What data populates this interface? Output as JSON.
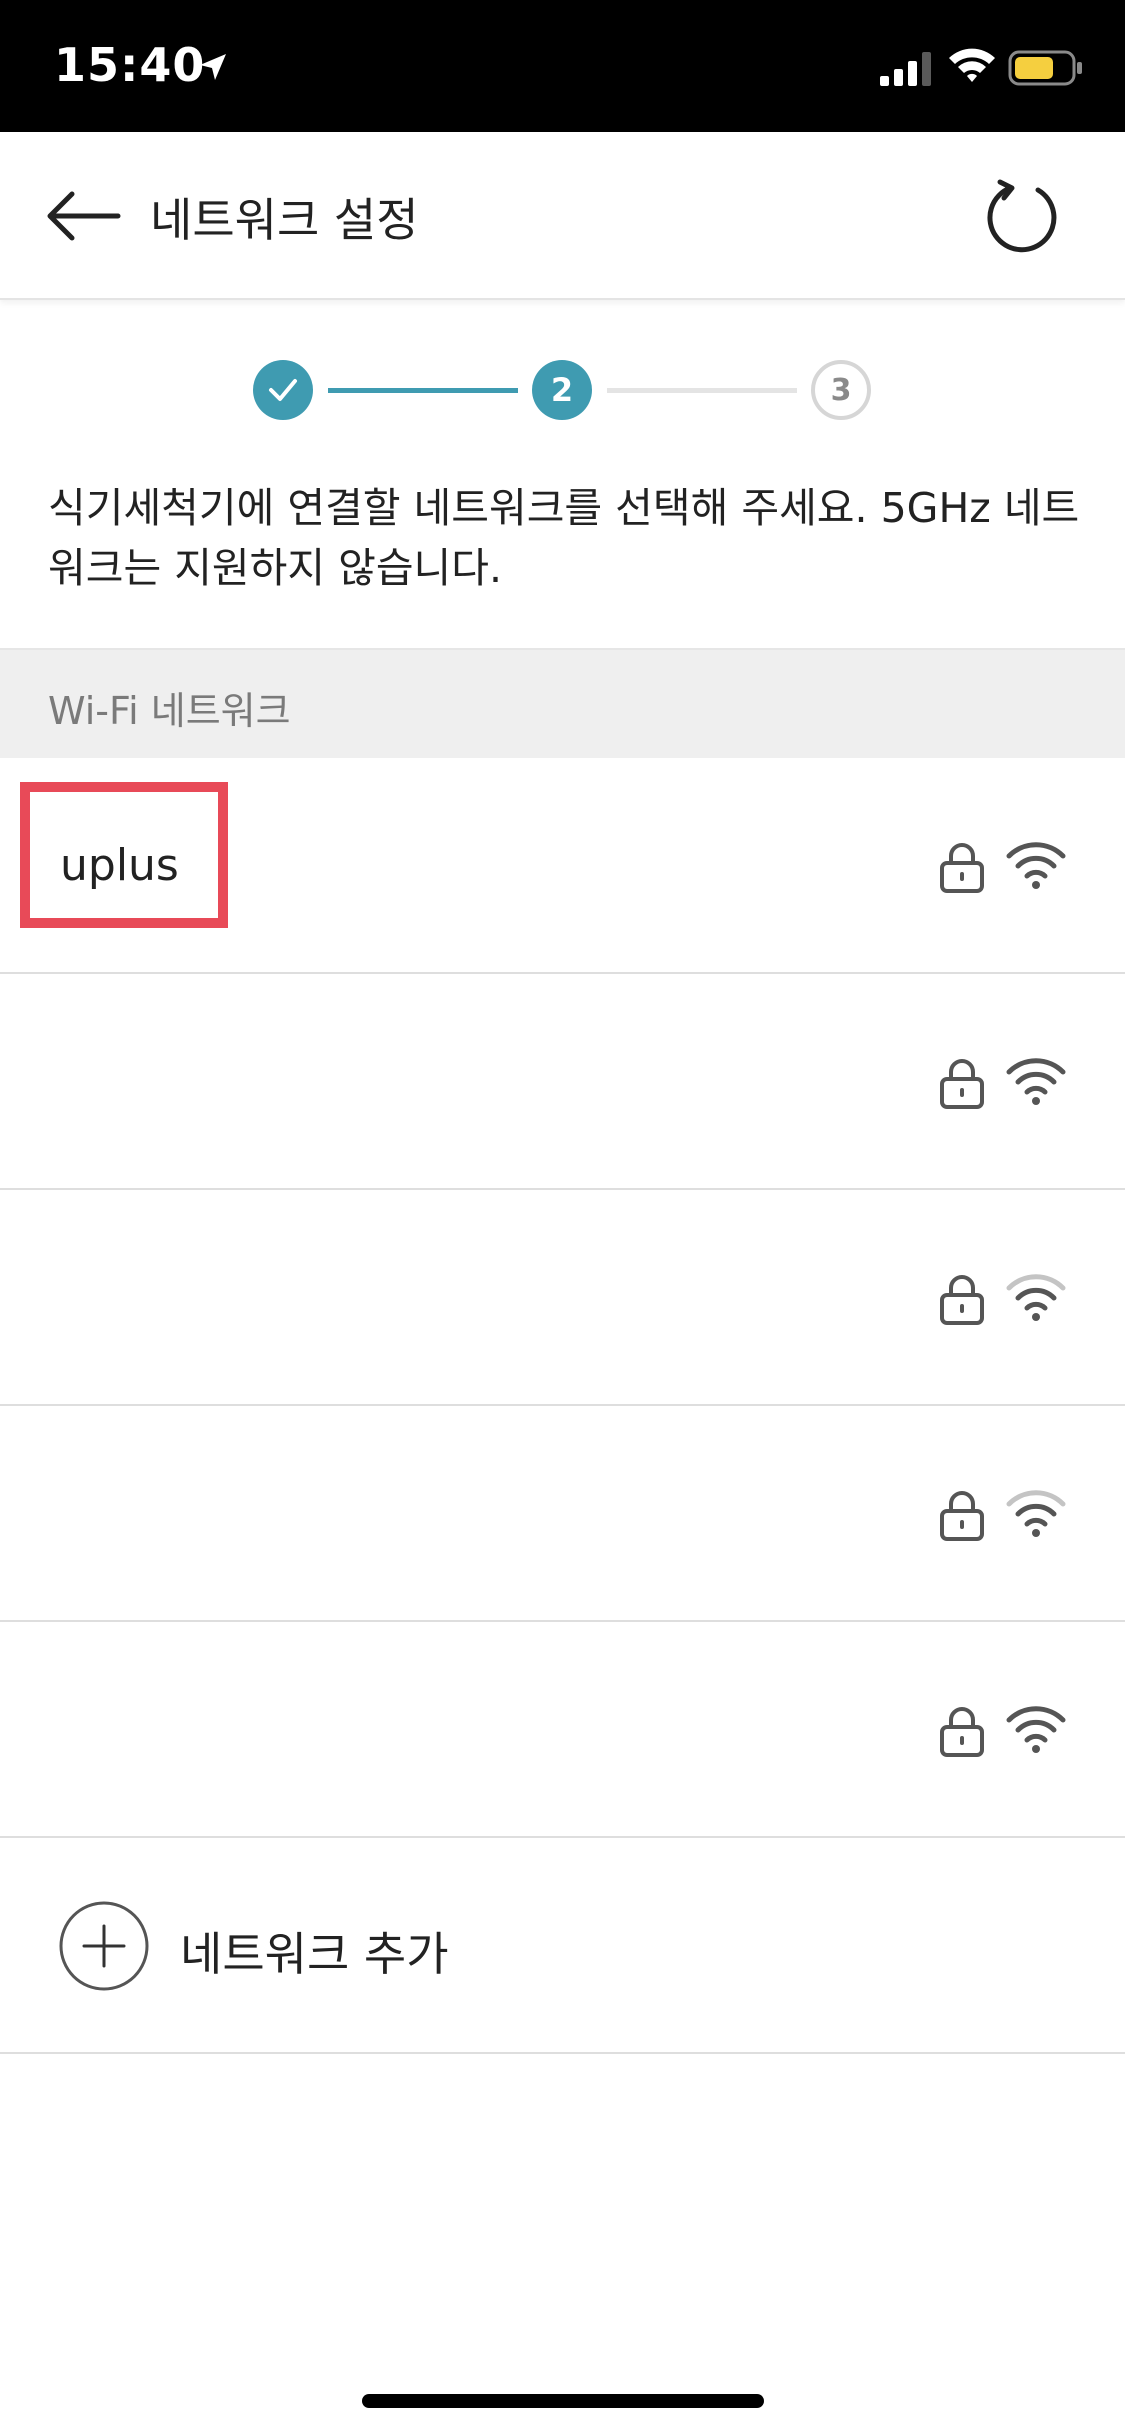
{
  "status_bar": {
    "time": "15:40",
    "icons": [
      "location-arrow-icon",
      "cellular-signal-icon",
      "wifi-icon",
      "battery-icon"
    ],
    "battery_color": "#f5cf3f"
  },
  "header": {
    "title": "네트워크 설정",
    "back_icon": "back-arrow-icon",
    "refresh_icon": "refresh-icon"
  },
  "stepper": {
    "steps": [
      {
        "label": "",
        "state": "completed"
      },
      {
        "label": "2",
        "state": "current"
      },
      {
        "label": "3",
        "state": "upcoming"
      }
    ],
    "accent_color": "#3f9bb1"
  },
  "description": "식기세척기에 연결할 네트워크를 선택해 주세요. 5GHz 네트워크는 지원하지 않습니다.",
  "section": {
    "label": "Wi-Fi 네트워크"
  },
  "networks": [
    {
      "name": "uplus",
      "locked": true,
      "signal": "strong",
      "highlighted": true
    },
    {
      "name": "",
      "locked": true,
      "signal": "strong"
    },
    {
      "name": "",
      "locked": true,
      "signal": "weak"
    },
    {
      "name": "",
      "locked": true,
      "signal": "weak"
    },
    {
      "name": "",
      "locked": true,
      "signal": "strong"
    }
  ],
  "add_network": {
    "label": "네트워크 추가",
    "icon": "plus-circle-icon"
  },
  "highlight_color": "#e84a58"
}
